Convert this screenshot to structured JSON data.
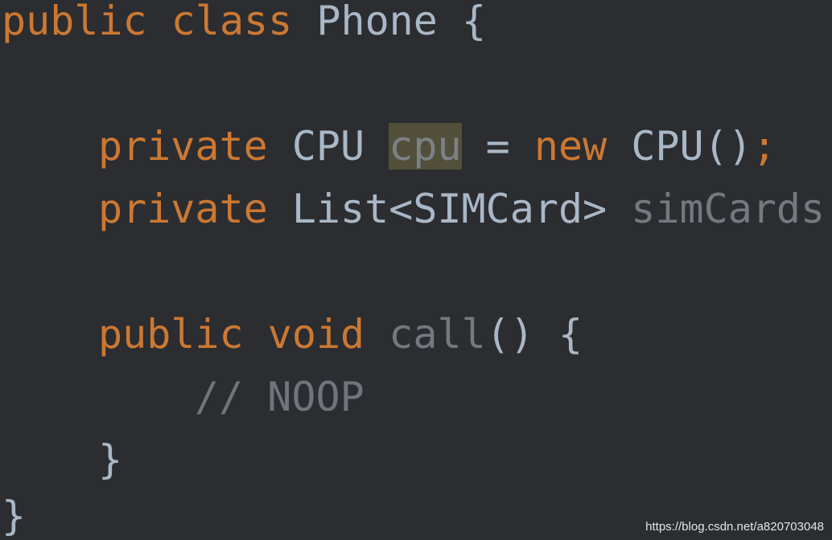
{
  "code": {
    "line1": {
      "kw_public": "public",
      "kw_class": "class",
      "class_name": "Phone",
      "brace_open": "{"
    },
    "line2": {
      "kw_private": "private",
      "type": "CPU",
      "field": "cpu",
      "assign": "=",
      "kw_new": "new",
      "ctor": "CPU()",
      "semi": ";"
    },
    "line3": {
      "kw_private": "private",
      "type": "List<SIMCard>",
      "field": "simCards",
      "semi": ";"
    },
    "line4": {
      "kw_public": "public",
      "kw_void": "void",
      "method": "call",
      "parens": "()",
      "brace_open": "{"
    },
    "line5": {
      "comment": "// NOOP"
    },
    "line6": {
      "brace_close": "}"
    },
    "line7": {
      "brace_close": "}"
    }
  },
  "watermark": "https://blog.csdn.net/a820703048",
  "colors": {
    "background": "#2b2d31",
    "keyword": "#cc7832",
    "identifier": "#a9b7c6",
    "unused": "#747980",
    "comment": "#6f757c",
    "highlight": "#52503a"
  }
}
